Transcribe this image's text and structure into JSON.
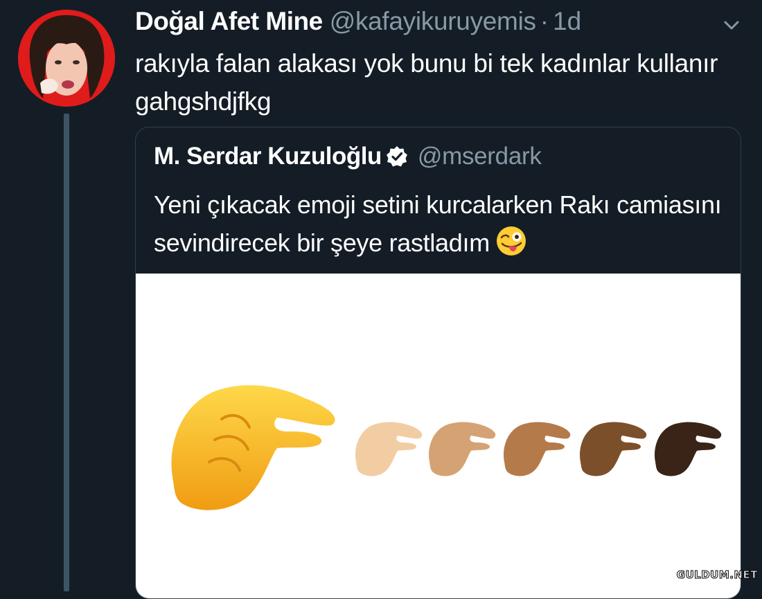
{
  "tweet": {
    "display_name": "Doğal Afet Mine",
    "handle": "@kafayikuruyemis",
    "separator": "·",
    "time": "1d",
    "text": "rakıyla falan alakası yok bunu bi tek kadınlar kullanır gahgshdjfkg",
    "menu_icon": "chevron-down-icon"
  },
  "quoted_tweet": {
    "display_name": "M. Serdar Kuzuloğlu",
    "verified_icon": "verified-badge-icon",
    "handle": "@mserdark",
    "text": "Yeni çıkacak emoji setini kurcalarken Rakı camiasını sevindirecek bir şeye rastladım",
    "trailing_emoji": "winking-face-with-tongue-emoji",
    "media": {
      "description_icons": [
        "pinching-hand-emoji-yellow",
        "pinching-hand-emoji-light",
        "pinching-hand-emoji-medium-light",
        "pinching-hand-emoji-medium",
        "pinching-hand-emoji-medium-dark",
        "pinching-hand-emoji-dark"
      ],
      "skin_tones": [
        "#f5b82e",
        "#f2cda4",
        "#d5a373",
        "#b47a4a",
        "#7c4f2b",
        "#3a2417"
      ]
    }
  },
  "watermark": "GULDUM.NET"
}
